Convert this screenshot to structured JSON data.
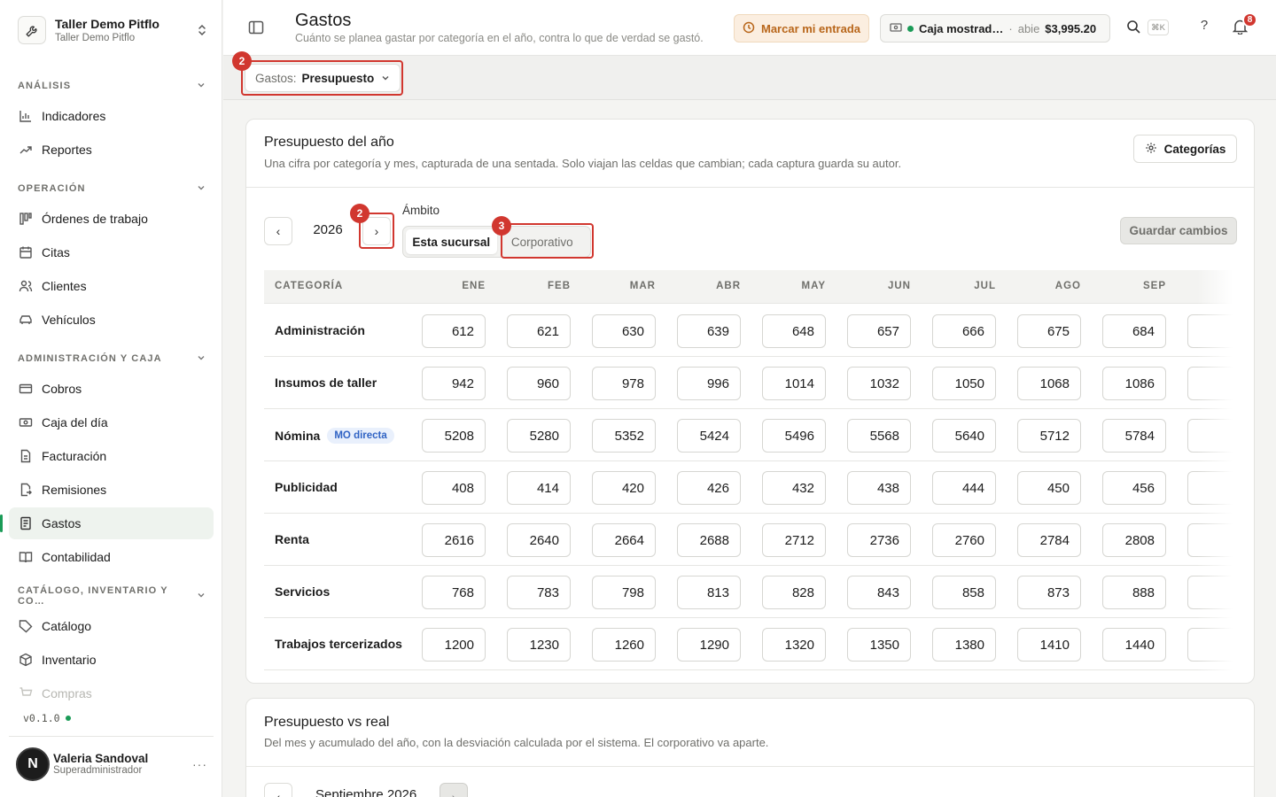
{
  "workspace": {
    "name": "Taller Demo Pitflo",
    "subtitle": "Taller Demo Pitflo"
  },
  "sidebar": {
    "sections": [
      {
        "label": "ANÁLISIS",
        "items": [
          "Indicadores",
          "Reportes"
        ]
      },
      {
        "label": "OPERACIÓN",
        "items": [
          "Órdenes de trabajo",
          "Citas",
          "Clientes",
          "Vehículos"
        ]
      },
      {
        "label": "ADMINISTRACIÓN Y CAJA",
        "items": [
          "Cobros",
          "Caja del día",
          "Facturación",
          "Remisiones",
          "Gastos",
          "Contabilidad"
        ]
      },
      {
        "label": "CATÁLOGO, INVENTARIO Y CO…",
        "items": [
          "Catálogo",
          "Inventario",
          "Compras"
        ]
      }
    ],
    "active_item": "Gastos",
    "version": "v0.1.0",
    "user": {
      "initial": "N",
      "name": "Valeria Sandoval",
      "role": "Superadministrador",
      "more": "···"
    }
  },
  "header": {
    "title": "Gastos",
    "subtitle": "Cuánto se planea gastar por categoría en el año, contra lo que de verdad se gastó.",
    "clock_in_label": "Marcar mi entrada",
    "cash": {
      "name": "Caja mostrad…",
      "separator": "·",
      "state": "abie",
      "amount": "$3,995.20"
    },
    "shortcut": "⌘K",
    "help": "?",
    "notifications": "8"
  },
  "toolbar": {
    "view_prefix": "Gastos:",
    "view_value": "Presupuesto"
  },
  "annotations": {
    "view_badge": "2",
    "next_badge": "2",
    "corp_badge": "3"
  },
  "budget": {
    "title": "Presupuesto del año",
    "description": "Una cifra por categoría y mes, capturada de una sentada. Solo viajan las celdas que cambian; cada captura guarda su autor.",
    "categories_button": "Categorías",
    "year": "2026",
    "prev": "‹",
    "next": "›",
    "scope_label": "Ámbito",
    "scope_options": [
      "Esta sucursal",
      "Corporativo"
    ],
    "scope_selected": "Esta sucursal",
    "save_label": "Guardar cambios",
    "columns": [
      "CATEGORÍA",
      "ENE",
      "FEB",
      "MAR",
      "ABR",
      "MAY",
      "JUN",
      "JUL",
      "AGO",
      "SEP"
    ],
    "rows": [
      {
        "name": "Administración",
        "tag": "",
        "values": [
          "612",
          "621",
          "630",
          "639",
          "648",
          "657",
          "666",
          "675",
          "684"
        ]
      },
      {
        "name": "Insumos de taller",
        "tag": "",
        "values": [
          "942",
          "960",
          "978",
          "996",
          "1014",
          "1032",
          "1050",
          "1068",
          "1086"
        ]
      },
      {
        "name": "Nómina",
        "tag": "MO directa",
        "values": [
          "5208",
          "5280",
          "5352",
          "5424",
          "5496",
          "5568",
          "5640",
          "5712",
          "5784"
        ]
      },
      {
        "name": "Publicidad",
        "tag": "",
        "values": [
          "408",
          "414",
          "420",
          "426",
          "432",
          "438",
          "444",
          "450",
          "456"
        ]
      },
      {
        "name": "Renta",
        "tag": "",
        "values": [
          "2616",
          "2640",
          "2664",
          "2688",
          "2712",
          "2736",
          "2760",
          "2784",
          "2808"
        ]
      },
      {
        "name": "Servicios",
        "tag": "",
        "values": [
          "768",
          "783",
          "798",
          "813",
          "828",
          "843",
          "858",
          "873",
          "888"
        ]
      },
      {
        "name": "Trabajos tercerizados",
        "tag": "",
        "values": [
          "1200",
          "1230",
          "1260",
          "1290",
          "1320",
          "1350",
          "1380",
          "1410",
          "1440"
        ]
      }
    ]
  },
  "versus": {
    "title": "Presupuesto vs real",
    "description": "Del mes y acumulado del año, con la desviación calculada por el sistema. El corporativo va aparte.",
    "month": "Septiembre 2026",
    "prev": "‹",
    "next": "›"
  },
  "colors": {
    "accent": "#1a9b57",
    "annotation": "#d1372f",
    "warning_bg": "#fbeee0",
    "warning_text": "#b8661a",
    "tag_text": "#3063c4"
  }
}
